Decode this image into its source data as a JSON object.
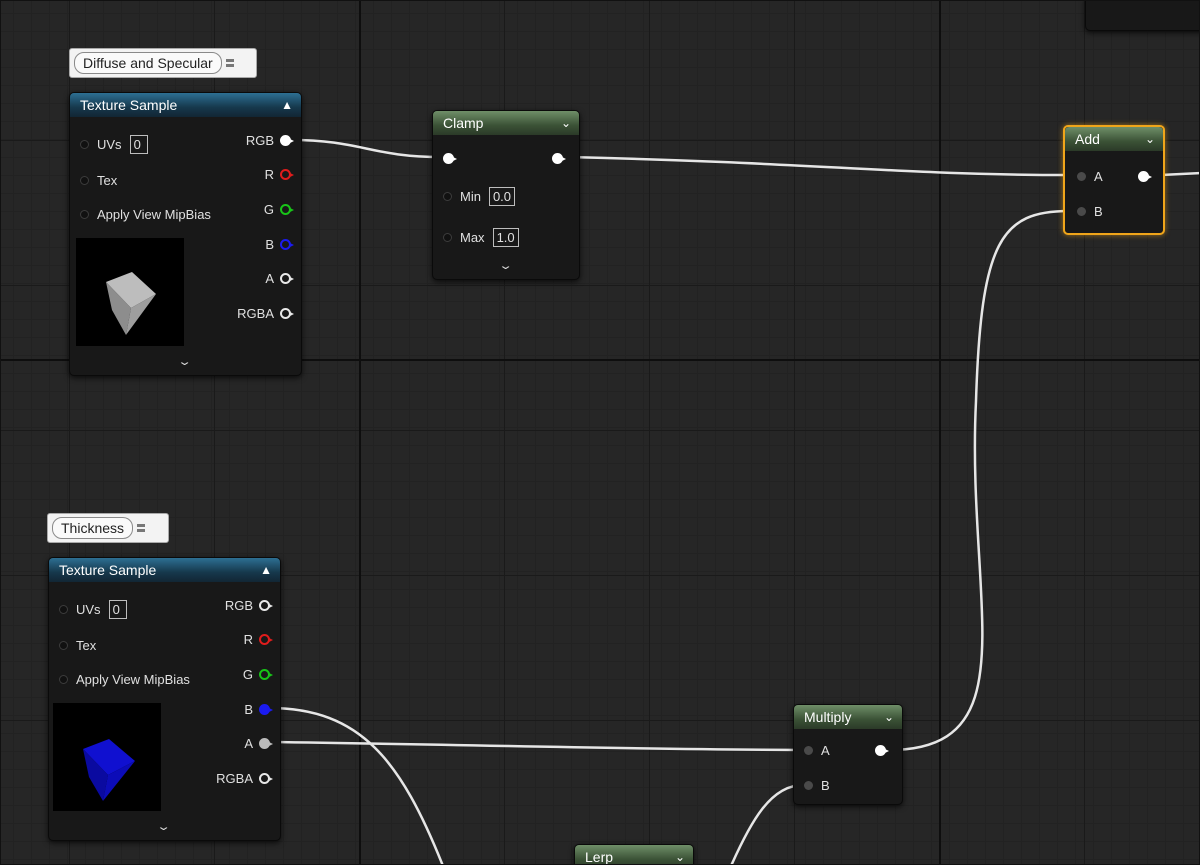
{
  "comments": {
    "top": "Diffuse and Specular",
    "bottom": "Thickness"
  },
  "texture_top": {
    "title": "Texture Sample",
    "inputs": [
      "UVs",
      "Tex",
      "Apply View MipBias"
    ],
    "uv_value": "0",
    "outputs": [
      "RGB",
      "R",
      "G",
      "B",
      "A",
      "RGBA"
    ]
  },
  "texture_bottom": {
    "title": "Texture Sample",
    "inputs": [
      "UVs",
      "Tex",
      "Apply View MipBias"
    ],
    "uv_value": "0",
    "outputs": [
      "RGB",
      "R",
      "G",
      "B",
      "A",
      "RGBA"
    ]
  },
  "clamp": {
    "title": "Clamp",
    "min_label": "Min",
    "min_value": "0.0",
    "max_label": "Max",
    "max_value": "1.0"
  },
  "add": {
    "title": "Add",
    "inputs": [
      "A",
      "B"
    ]
  },
  "multiply": {
    "title": "Multiply",
    "inputs": [
      "A",
      "B"
    ]
  },
  "lerp": {
    "title": "Lerp"
  },
  "colors": {
    "selection": "#f0a51a",
    "pin_red": "#e01c1c",
    "pin_green": "#18c418",
    "pin_blue": "#1b1bf0"
  },
  "icons": {
    "collapse": "chevron-up-icon",
    "expand": "chevron-down-icon"
  }
}
